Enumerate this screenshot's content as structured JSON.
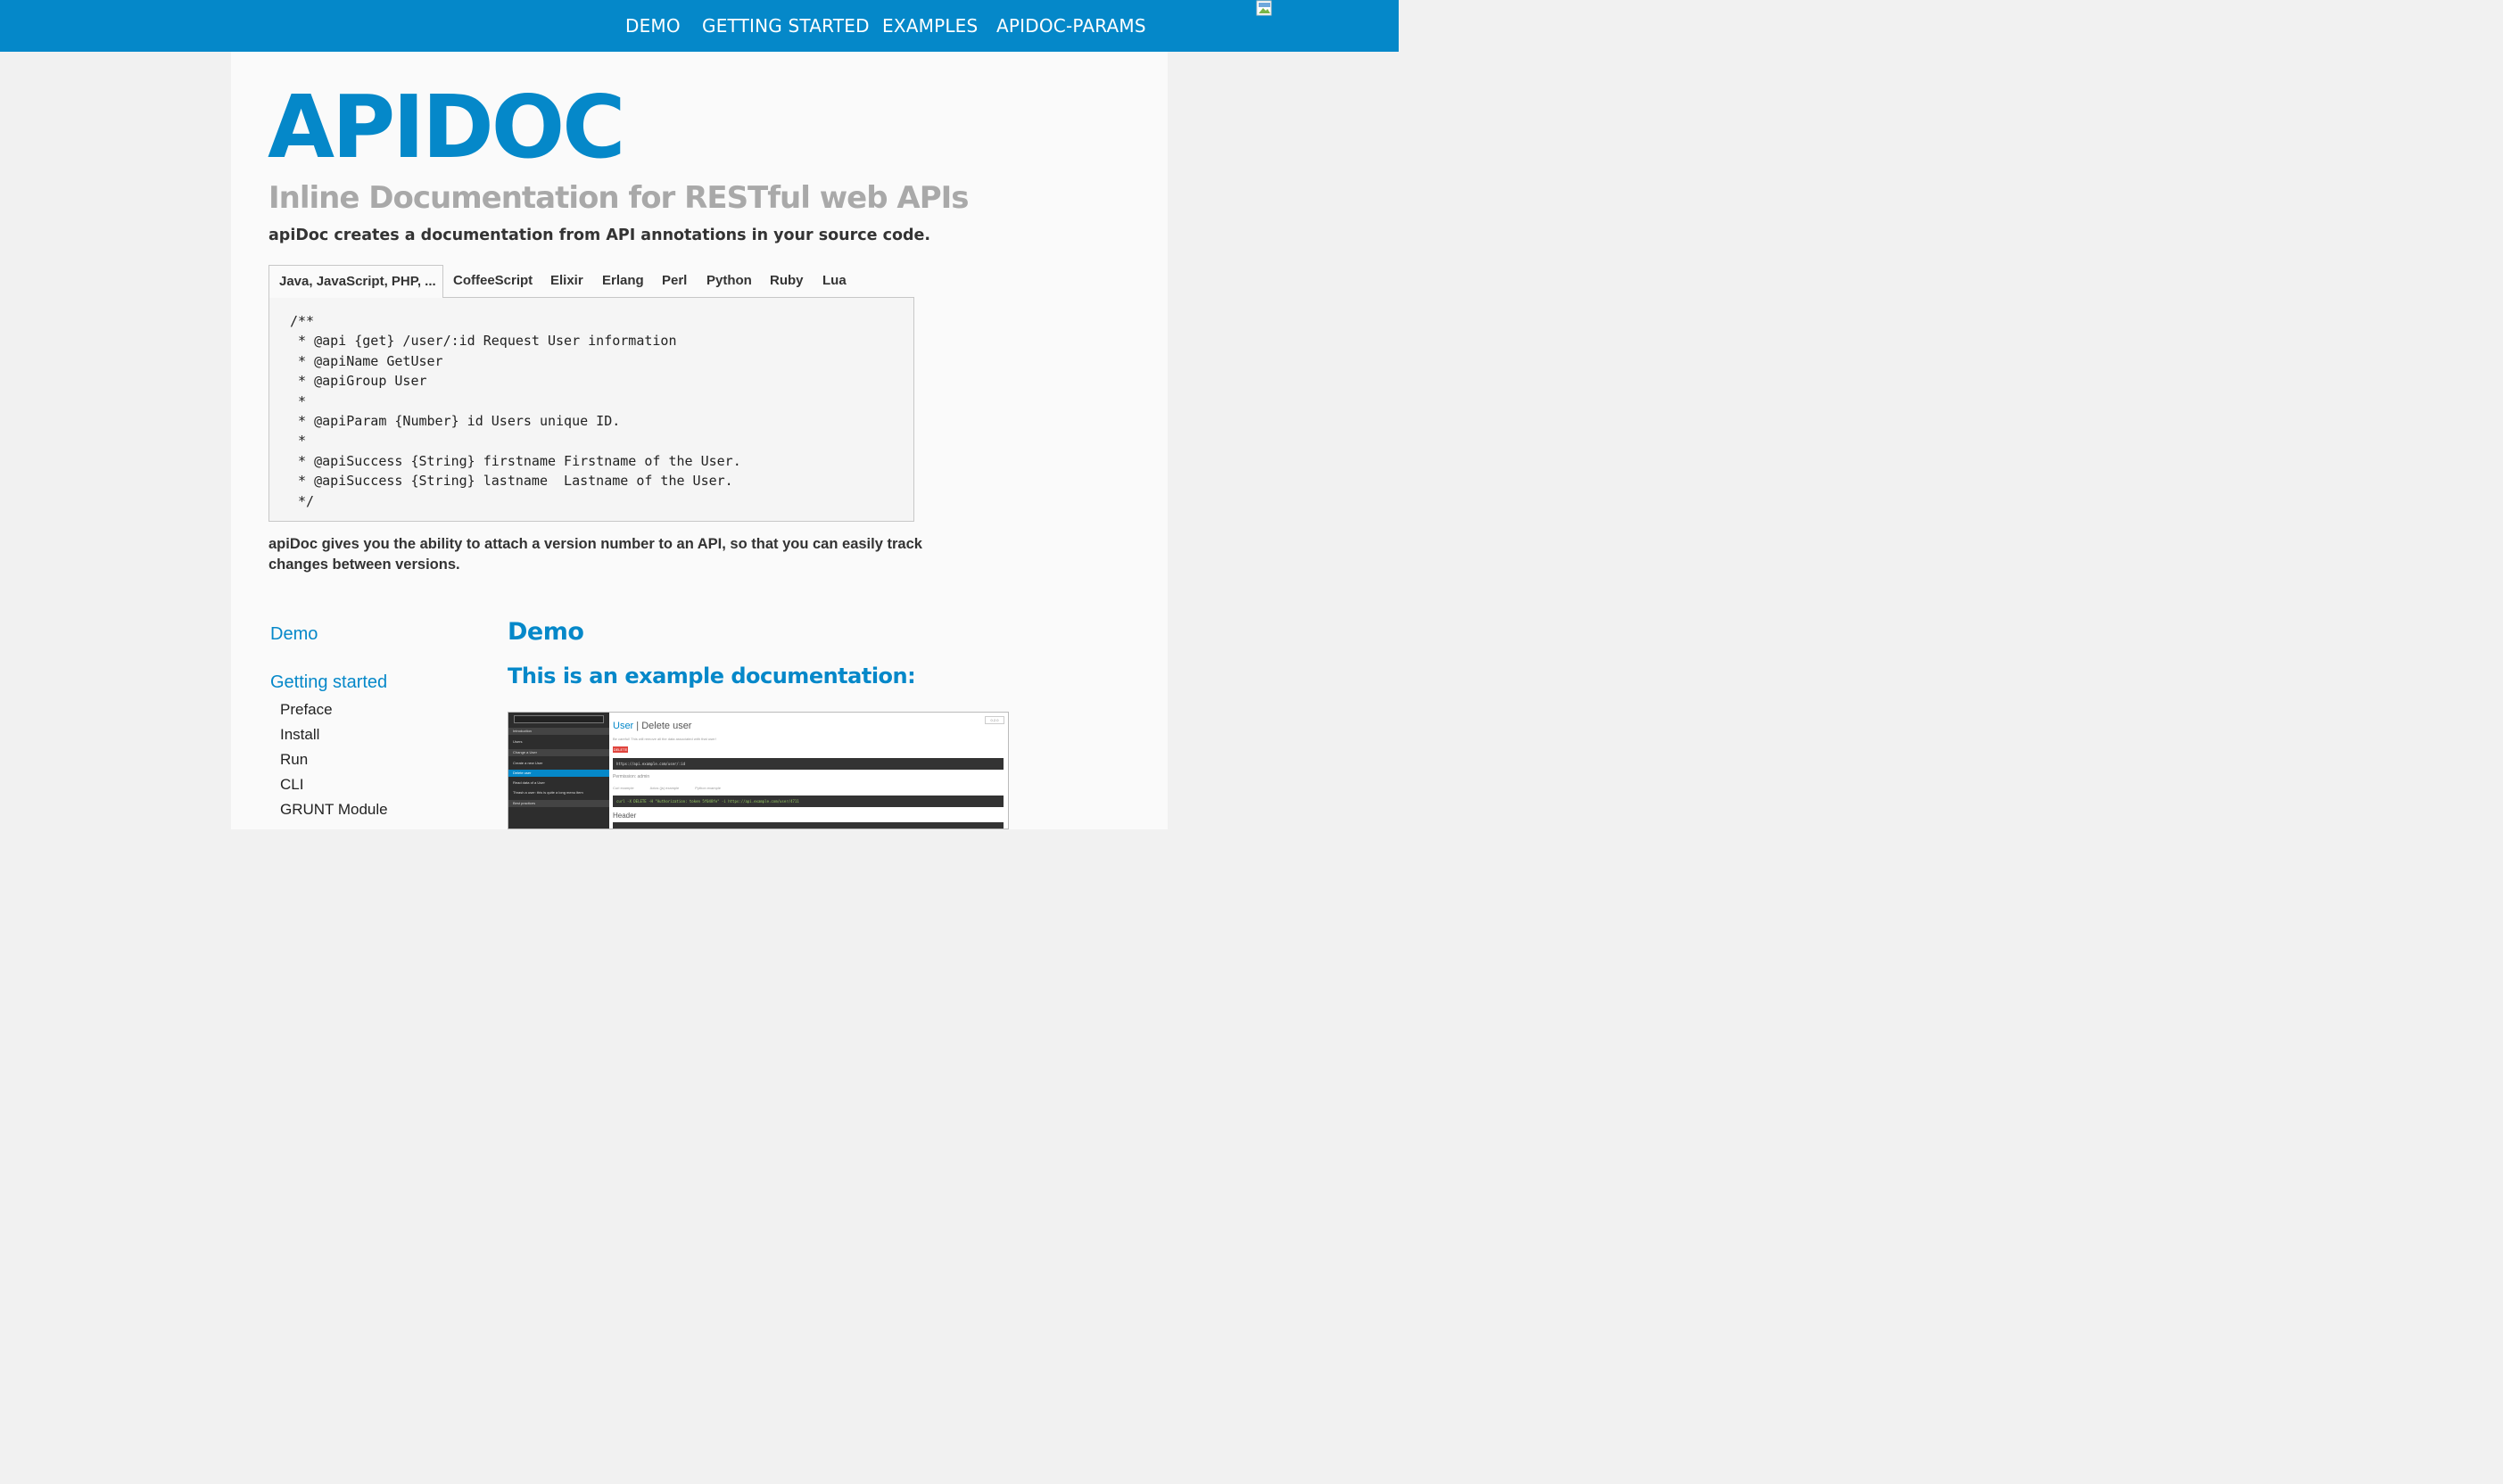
{
  "nav": {
    "items": [
      "DEMO",
      "GETTING STARTED",
      "EXAMPLES",
      "APIDOC-PARAMS"
    ]
  },
  "header": {
    "title": "APIDOC",
    "subtitle": "Inline Documentation for RESTful web APIs",
    "lead": "apiDoc creates a documentation from API annotations in your source code."
  },
  "tabs": [
    "Java, JavaScript, PHP, ...",
    "CoffeeScript",
    "Elixir",
    "Erlang",
    "Perl",
    "Python",
    "Ruby",
    "Lua"
  ],
  "code": "/**\n * @api {get} /user/:id Request User information\n * @apiName GetUser\n * @apiGroup User\n *\n * @apiParam {Number} id Users unique ID.\n *\n * @apiSuccess {String} firstname Firstname of the User.\n * @apiSuccess {String} lastname  Lastname of the User.\n */",
  "description": "apiDoc gives you the ability to attach a version number to an API, so that you can easily track changes between versions.",
  "sidenav": {
    "demo": "Demo",
    "getting_started": "Getting started",
    "sub": [
      "Preface",
      "Install",
      "Run",
      "CLI",
      "GRUNT Module"
    ]
  },
  "content": {
    "heading": "Demo",
    "subheading": "This is an example documentation:"
  },
  "preview": {
    "search_placeholder": "Filter...",
    "side_items": [
      "Introduction",
      "Users",
      "Change a User",
      "Create a new User",
      "Delete user",
      "Read data of a User",
      "Thrash a user: this is quite a long menu item",
      "Best practices"
    ],
    "version": "0.2.0",
    "title_group": "User",
    "title_sep": " | ",
    "title_name": "Delete user",
    "note": "Be careful! This will remove all the data associated with that user!",
    "method": "DELETE",
    "url": "https://api.example.com/user/:id",
    "permission": "Permission: admin",
    "example_tabs": [
      "Curl example",
      "Axios (js) example",
      "Python example"
    ],
    "curl": "curl -X DELETE -H \"Authorization: token 5f048fe\" -i https://api.example.com/user/4711",
    "header_label": "Header"
  },
  "colors": {
    "brand": "#0588c9",
    "background": "#f1f1f1",
    "panel": "#fafafa",
    "muted_title": "#a9a9a9"
  }
}
